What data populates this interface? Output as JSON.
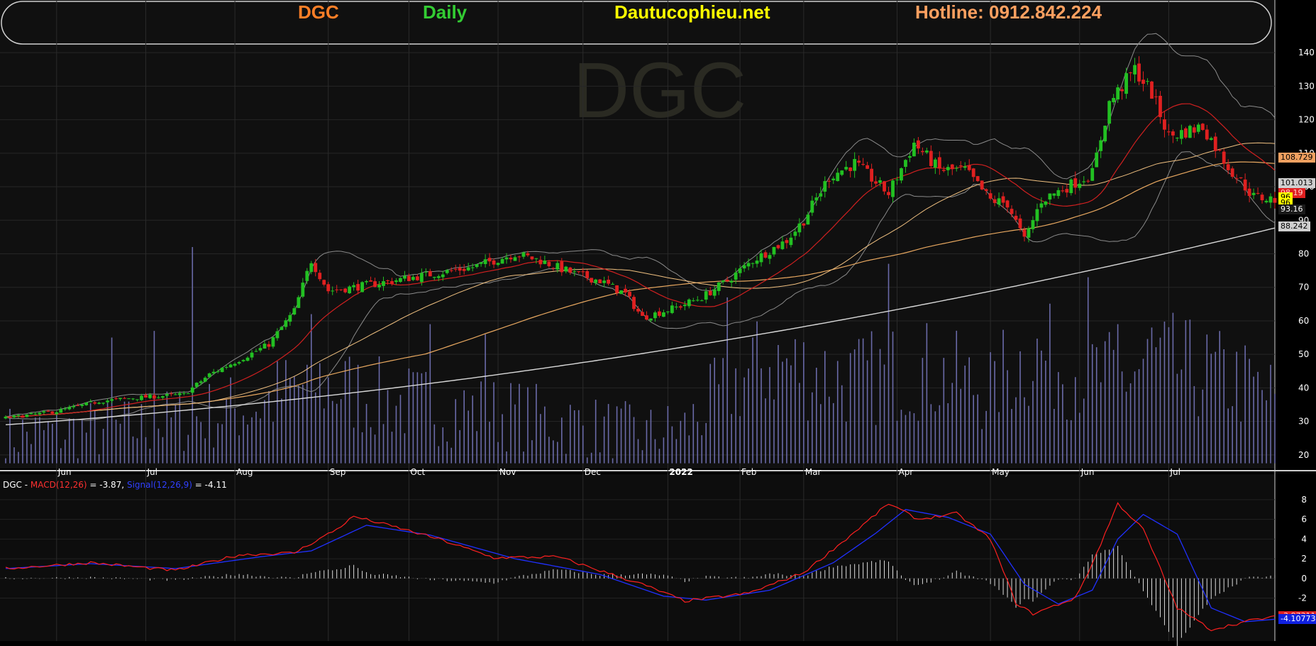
{
  "header": {
    "symbol": "DGC",
    "interval": "Daily",
    "site": "Dautucophieu.net",
    "hotline": "Hotline: 0912.842.224",
    "colors": {
      "symbol": "#ff7f27",
      "interval": "#33cc33",
      "site": "#ffff00",
      "hotline": "#ffa060"
    }
  },
  "watermark": "DGC",
  "macd_label": {
    "symbol": "DGC - ",
    "macd_name": "MACD(12,26)",
    "macd_value": " = -3.87, ",
    "signal_name": "Signal(12,26,9)",
    "signal_value": " = -4.11"
  },
  "price_tags": [
    {
      "text": "108.729",
      "bg": "#f0a060",
      "fg": "#000",
      "price": 108.729
    },
    {
      "text": "101.013",
      "bg": "#cfcfcf",
      "fg": "#000",
      "price": 101.013
    },
    {
      "text": "98.19",
      "bg": "#e02020",
      "fg": "#ffd0d0",
      "price": 98.19
    },
    {
      "text": "96",
      "bg": "#ffff00",
      "fg": "#000",
      "price": 96.9
    },
    {
      "text": "96",
      "bg": "#ffff00",
      "fg": "#000",
      "price": 95.1
    },
    {
      "text": "93.16",
      "bg": "#1a1a1a",
      "fg": "#fff",
      "price": 93.16
    },
    {
      "text": "88.242",
      "bg": "#cfcfcf",
      "fg": "#000",
      "price": 88.242
    }
  ],
  "macd_tags": [
    {
      "text": "-3.87311",
      "bg": "#e02020",
      "fg": "#ffd0d0",
      "value": -3.87
    },
    {
      "text": "-4.10773",
      "bg": "#1020e0",
      "fg": "#fff",
      "value": -4.11
    }
  ],
  "chart_data": {
    "type": "candlestick",
    "price_axis": {
      "ticks": [
        20,
        30,
        40,
        50,
        60,
        70,
        80,
        90,
        100,
        110,
        120,
        130,
        140
      ],
      "range": [
        17,
        143
      ]
    },
    "macd_axis": {
      "ticks": [
        -2,
        0,
        2,
        4,
        6,
        8
      ],
      "range": [
        -6,
        9
      ]
    },
    "x_labels": [
      "Jun",
      "Jul",
      "Aug",
      "Sep",
      "Oct",
      "Nov",
      "Dec",
      "2022",
      "Feb",
      "Mar",
      "Apr",
      "May",
      "Jun",
      "Jul"
    ],
    "price_path": [
      [
        0,
        31
      ],
      [
        12,
        33
      ],
      [
        22,
        36
      ],
      [
        30,
        37
      ],
      [
        36,
        37.5
      ],
      [
        42,
        38
      ],
      [
        48,
        44
      ],
      [
        56,
        49
      ],
      [
        62,
        53
      ],
      [
        68,
        63
      ],
      [
        72,
        78
      ],
      [
        76,
        69
      ],
      [
        82,
        70
      ],
      [
        96,
        73
      ],
      [
        110,
        76
      ],
      [
        120,
        80
      ],
      [
        126,
        78
      ],
      [
        134,
        74
      ],
      [
        140,
        72
      ],
      [
        146,
        68
      ],
      [
        150,
        61
      ],
      [
        158,
        64
      ],
      [
        164,
        67
      ],
      [
        170,
        72
      ],
      [
        176,
        78
      ],
      [
        184,
        84
      ],
      [
        188,
        90
      ],
      [
        194,
        103
      ],
      [
        200,
        107
      ],
      [
        208,
        98
      ],
      [
        214,
        113
      ],
      [
        220,
        105
      ],
      [
        226,
        105
      ],
      [
        232,
        96
      ],
      [
        236,
        95
      ],
      [
        240,
        84
      ],
      [
        244,
        96
      ],
      [
        250,
        100
      ],
      [
        256,
        104
      ],
      [
        260,
        125
      ],
      [
        266,
        135
      ],
      [
        270,
        128
      ],
      [
        274,
        115
      ],
      [
        282,
        118
      ],
      [
        288,
        106
      ],
      [
        294,
        97
      ],
      [
        300,
        96
      ]
    ],
    "volume_path": [
      [
        0,
        26
      ],
      [
        30,
        28
      ],
      [
        48,
        32
      ],
      [
        60,
        35
      ],
      [
        72,
        42
      ],
      [
        90,
        36
      ],
      [
        120,
        32
      ],
      [
        150,
        26
      ],
      [
        160,
        28
      ],
      [
        170,
        40
      ],
      [
        180,
        48
      ],
      [
        200,
        42
      ],
      [
        215,
        46
      ],
      [
        230,
        40
      ],
      [
        242,
        50
      ],
      [
        262,
        42
      ],
      [
        270,
        48
      ],
      [
        290,
        42
      ],
      [
        300,
        36
      ]
    ],
    "volume_spikes": [
      [
        25,
        55
      ],
      [
        35,
        57
      ],
      [
        44,
        82
      ],
      [
        72,
        62
      ],
      [
        80,
        48
      ],
      [
        100,
        59
      ],
      [
        113,
        56
      ],
      [
        170,
        67
      ],
      [
        176,
        55
      ],
      [
        208,
        77
      ],
      [
        233,
        48
      ],
      [
        255,
        73
      ],
      [
        262,
        59
      ],
      [
        270,
        58
      ],
      [
        300,
        52
      ]
    ],
    "macd_path": [
      [
        0,
        1
      ],
      [
        20,
        1.6
      ],
      [
        40,
        0.8
      ],
      [
        55,
        2.4
      ],
      [
        68,
        2.6
      ],
      [
        78,
        5
      ],
      [
        82,
        6.3
      ],
      [
        92,
        5.2
      ],
      [
        102,
        4
      ],
      [
        115,
        2.1
      ],
      [
        130,
        2.2
      ],
      [
        150,
        -0.6
      ],
      [
        160,
        -2.3
      ],
      [
        175,
        -1.5
      ],
      [
        188,
        0.6
      ],
      [
        198,
        4
      ],
      [
        208,
        7.6
      ],
      [
        215,
        6
      ],
      [
        224,
        6.6
      ],
      [
        232,
        4
      ],
      [
        238,
        -2.5
      ],
      [
        242,
        -3.6
      ],
      [
        252,
        -2
      ],
      [
        256,
        1.5
      ],
      [
        262,
        7.6
      ],
      [
        268,
        5
      ],
      [
        276,
        -3
      ],
      [
        284,
        -5.2
      ],
      [
        294,
        -4.2
      ],
      [
        300,
        -3.87
      ]
    ],
    "signal_path": [
      [
        0,
        1
      ],
      [
        20,
        1.5
      ],
      [
        40,
        1
      ],
      [
        60,
        2.2
      ],
      [
        72,
        2.8
      ],
      [
        85,
        5.4
      ],
      [
        100,
        4.4
      ],
      [
        120,
        2
      ],
      [
        140,
        0.4
      ],
      [
        155,
        -1.8
      ],
      [
        165,
        -2.2
      ],
      [
        180,
        -1.2
      ],
      [
        195,
        1.6
      ],
      [
        205,
        4.6
      ],
      [
        212,
        7
      ],
      [
        222,
        6.2
      ],
      [
        232,
        4.5
      ],
      [
        240,
        -0.6
      ],
      [
        248,
        -2.6
      ],
      [
        256,
        -1.2
      ],
      [
        262,
        4
      ],
      [
        268,
        6.5
      ],
      [
        276,
        4.5
      ],
      [
        284,
        -3
      ],
      [
        292,
        -4.4
      ],
      [
        300,
        -4.11
      ]
    ]
  }
}
